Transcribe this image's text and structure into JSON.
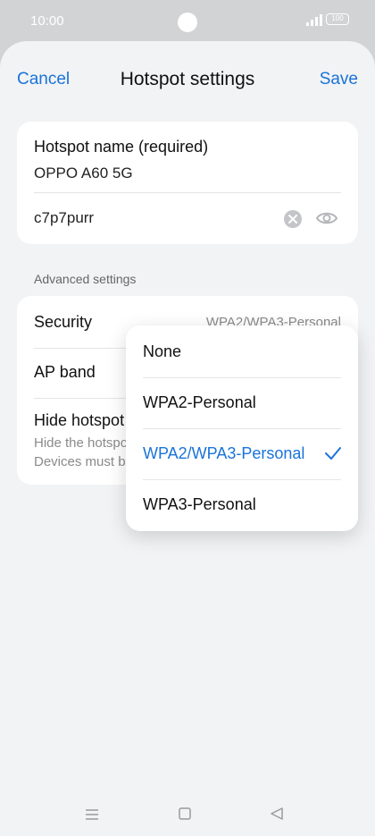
{
  "status_bar": {
    "time": "10:00",
    "battery": "100"
  },
  "header": {
    "cancel_label": "Cancel",
    "title": "Hotspot settings",
    "save_label": "Save"
  },
  "hotspot": {
    "name_label": "Hotspot name (required)",
    "name_value": "OPPO A60 5G",
    "password_value": "c7p7purr",
    "clear_icon": "clear-circle-icon",
    "visibility_icon": "eye-icon"
  },
  "advanced": {
    "section_label": "Advanced settings",
    "security_label": "Security",
    "security_value": "WPA2/WPA3-Personal",
    "ap_band_label": "AP band",
    "hide_label": "Hide hotspot",
    "hide_desc": "Hide the hotspot name so it can't be found. Devices must be connected to manually."
  },
  "dropdown": {
    "options": [
      {
        "label": "None",
        "selected": false
      },
      {
        "label": "WPA2-Personal",
        "selected": false
      },
      {
        "label": "WPA2/WPA3-Personal",
        "selected": true
      },
      {
        "label": "WPA3-Personal",
        "selected": false
      }
    ],
    "check_icon": "checkmark-icon"
  },
  "navbar": {
    "icons": [
      "menu-icon",
      "home-icon",
      "back-icon"
    ]
  },
  "colors": {
    "accent": "#1a73d9",
    "background": "#f2f3f5",
    "card": "#ffffff"
  }
}
